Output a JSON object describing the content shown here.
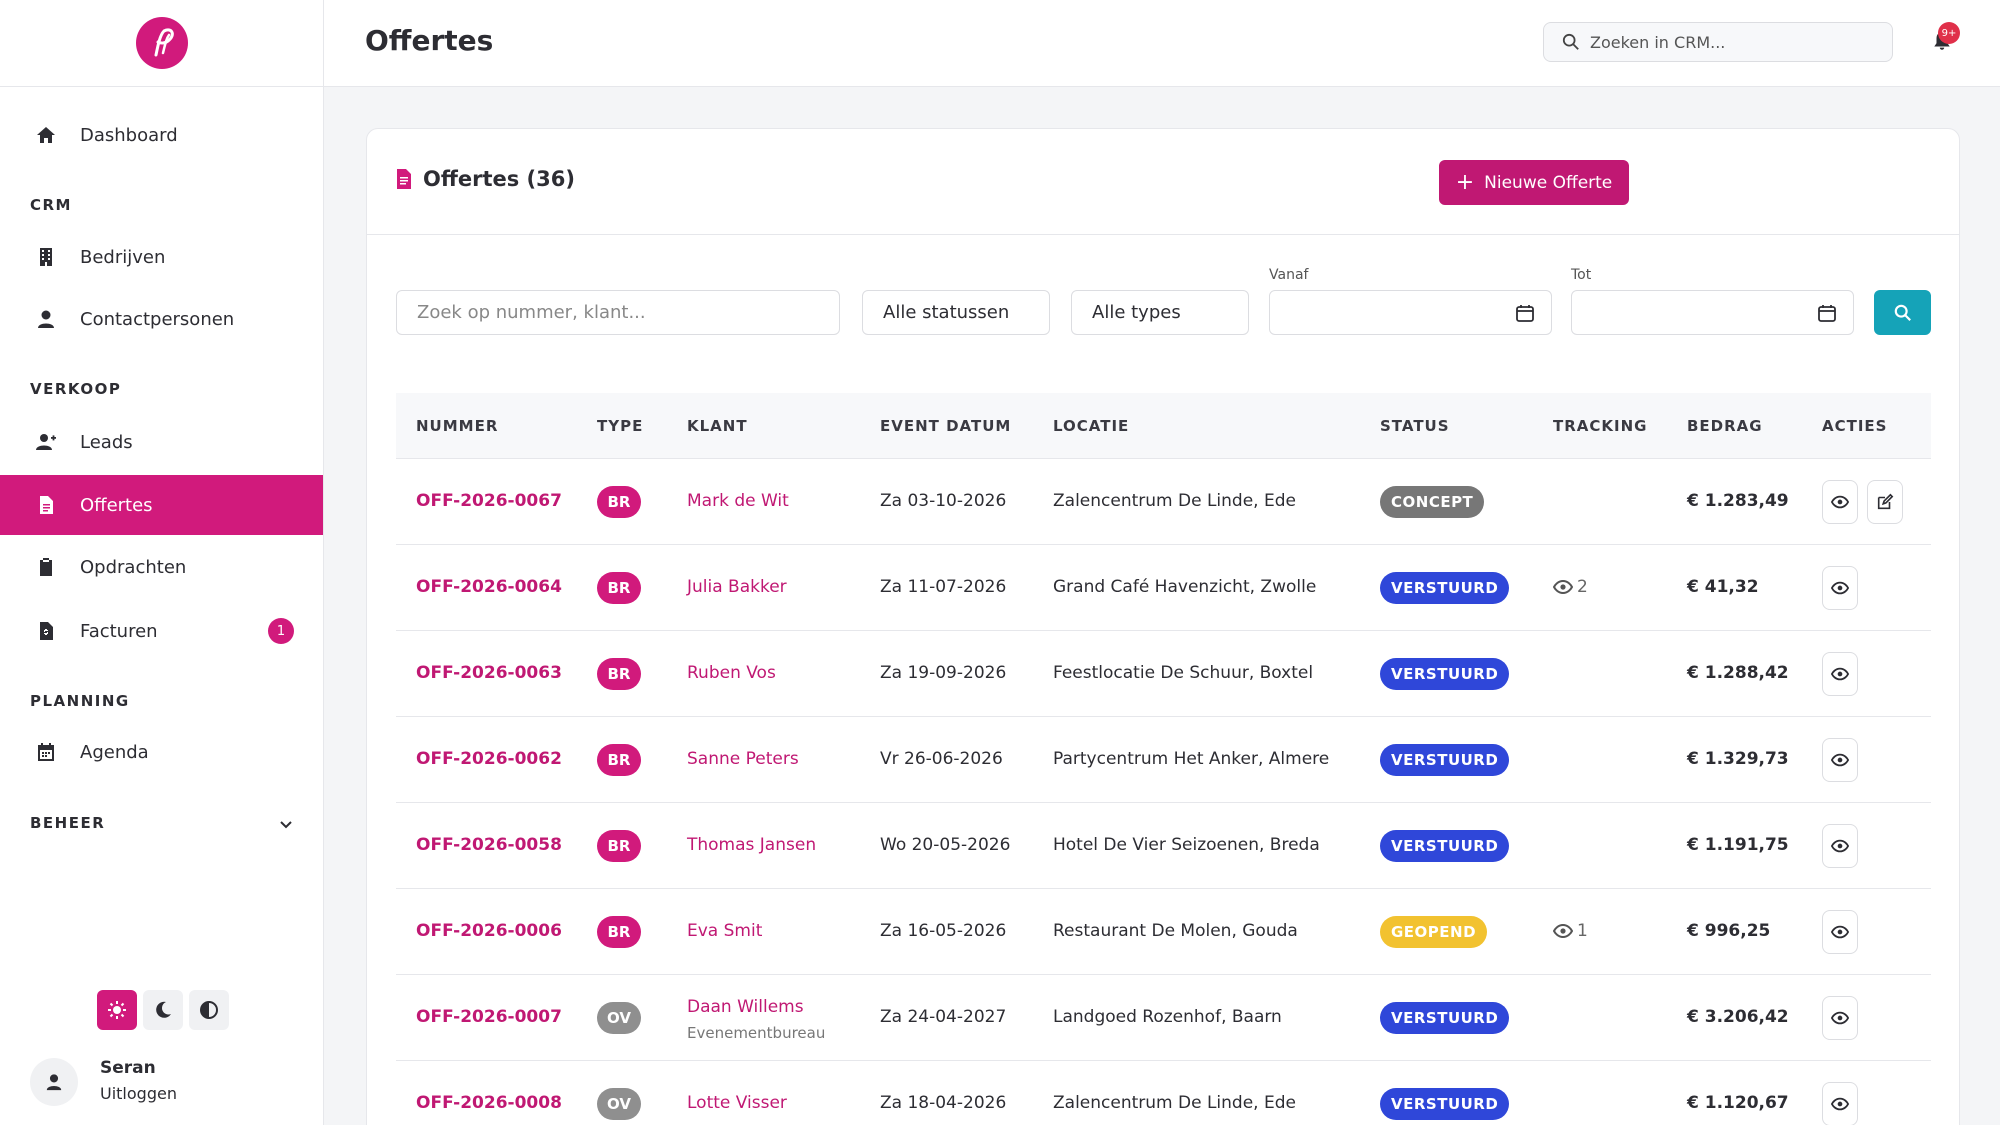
{
  "colors": {
    "brand": "#d11a7c",
    "teal": "#15a3b8",
    "concept": "#777777",
    "verstuurd": "#2f47d9",
    "geopend": "#f2c230",
    "type_br": "#d11a7c",
    "type_ov": "#8f8f8f"
  },
  "sidebar": {
    "logo_icon": "brand-logo",
    "dashboard": "Dashboard",
    "section_crm": "CRM",
    "bedrijven": "Bedrijven",
    "contactpersonen": "Contactpersonen",
    "section_verkoop": "VERKOOP",
    "leads": "Leads",
    "offertes": "Offertes",
    "opdrachten": "Opdrachten",
    "facturen": "Facturen",
    "facturen_badge": "1",
    "section_planning": "PLANNING",
    "agenda": "Agenda",
    "section_beheer": "BEHEER",
    "user_name": "Seran",
    "logout": "Uitloggen"
  },
  "header": {
    "title": "Offertes",
    "search_placeholder": "Zoeken in CRM...",
    "notif_badge": "9+"
  },
  "card": {
    "title": "Offertes (36)",
    "new_button": "Nieuwe Offerte",
    "filters": {
      "search_placeholder": "Zoek op nummer, klant...",
      "status": "Alle statussen",
      "types": "Alle types",
      "from_label": "Vanaf",
      "to_label": "Tot"
    },
    "columns": [
      "NUMMER",
      "TYPE",
      "KLANT",
      "EVENT DATUM",
      "LOCATIE",
      "STATUS",
      "TRACKING",
      "BEDRAG",
      "ACTIES"
    ]
  },
  "rows": [
    {
      "nummer": "OFF-2026-0067",
      "type": "BR",
      "klant": "Mark de Wit",
      "klant_sub": "",
      "datum": "Za 03-10-2026",
      "locatie": "Zalencentrum De Linde, Ede",
      "status": "CONCEPT",
      "tracking": "",
      "bedrag": "€ 1.283,49"
    },
    {
      "nummer": "OFF-2026-0064",
      "type": "BR",
      "klant": "Julia Bakker",
      "klant_sub": "",
      "datum": "Za 11-07-2026",
      "locatie": "Grand Café Havenzicht, Zwolle",
      "status": "VERSTUURD",
      "tracking": "2",
      "bedrag": "€ 41,32"
    },
    {
      "nummer": "OFF-2026-0063",
      "type": "BR",
      "klant": "Ruben Vos",
      "klant_sub": "",
      "datum": "Za 19-09-2026",
      "locatie": "Feestlocatie De Schuur, Boxtel",
      "status": "VERSTUURD",
      "tracking": "",
      "bedrag": "€ 1.288,42"
    },
    {
      "nummer": "OFF-2026-0062",
      "type": "BR",
      "klant": "Sanne Peters",
      "klant_sub": "",
      "datum": "Vr 26-06-2026",
      "locatie": "Partycentrum Het Anker, Almere",
      "status": "VERSTUURD",
      "tracking": "",
      "bedrag": "€ 1.329,73"
    },
    {
      "nummer": "OFF-2026-0058",
      "type": "BR",
      "klant": "Thomas Jansen",
      "klant_sub": "",
      "datum": "Wo 20-05-2026",
      "locatie": "Hotel De Vier Seizoenen, Breda",
      "status": "VERSTUURD",
      "tracking": "",
      "bedrag": "€ 1.191,75"
    },
    {
      "nummer": "OFF-2026-0006",
      "type": "BR",
      "klant": "Eva Smit",
      "klant_sub": "",
      "datum": "Za 16-05-2026",
      "locatie": "Restaurant De Molen, Gouda",
      "status": "GEOPEND",
      "tracking": "1",
      "bedrag": "€ 996,25"
    },
    {
      "nummer": "OFF-2026-0007",
      "type": "OV",
      "klant": "Daan Willems",
      "klant_sub": "Evenementbureau",
      "datum": "Za 24-04-2027",
      "locatie": "Landgoed Rozenhof, Baarn",
      "status": "VERSTUURD",
      "tracking": "",
      "bedrag": "€ 3.206,42"
    },
    {
      "nummer": "OFF-2026-0008",
      "type": "OV",
      "klant": "Lotte Visser",
      "klant_sub": "",
      "datum": "Za 18-04-2026",
      "locatie": "Zalencentrum De Linde, Ede",
      "status": "VERSTUURD",
      "tracking": "",
      "bedrag": "€ 1.120,67"
    }
  ]
}
